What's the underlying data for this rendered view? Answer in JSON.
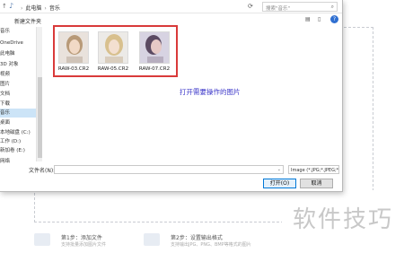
{
  "address": {
    "up": "↑",
    "crumbs": [
      "此电脑",
      "音乐"
    ],
    "search_placeholder": "搜索\"音乐\""
  },
  "toolbar": {
    "new_folder": "新建文件夹"
  },
  "sidebar": {
    "items": [
      {
        "label": "音乐"
      },
      {
        "label": "OneDrive"
      },
      {
        "label": "此电脑"
      },
      {
        "label": "3D 对象"
      },
      {
        "label": "视频"
      },
      {
        "label": "图片"
      },
      {
        "label": "文档"
      },
      {
        "label": "下载"
      },
      {
        "label": "音乐",
        "selected": true
      },
      {
        "label": "桌面"
      },
      {
        "label": "本地磁盘 (C:)"
      },
      {
        "label": "工作 (D:)"
      },
      {
        "label": "新加卷 (E:)"
      },
      {
        "label": "网络"
      }
    ]
  },
  "files": [
    {
      "name": "RAW-03.CR2"
    },
    {
      "name": "RAW-05.CR2"
    },
    {
      "name": "RAW-07.CR2"
    }
  ],
  "annotation": "打开需要操作的图片",
  "bottom": {
    "filename_label": "文件名(N):",
    "filter_value": "Image (*.JPG;*.JPEG;*.PNG;*.",
    "open_label": "打开(O)",
    "cancel_label": "取消"
  },
  "background": {
    "steps": [
      {
        "title": "第1步：添加文件",
        "desc": "支持批量添加图片文件"
      },
      {
        "title": "第2步：设置输出格式",
        "desc": "支持输出JPG、PNG、BMP等格式的图片"
      }
    ],
    "watermark": "软件技巧"
  },
  "colors": {
    "selection_frame": "#d93a3a",
    "annotation": "#3a35c8",
    "sidebar_selected": "#cce4f7"
  }
}
